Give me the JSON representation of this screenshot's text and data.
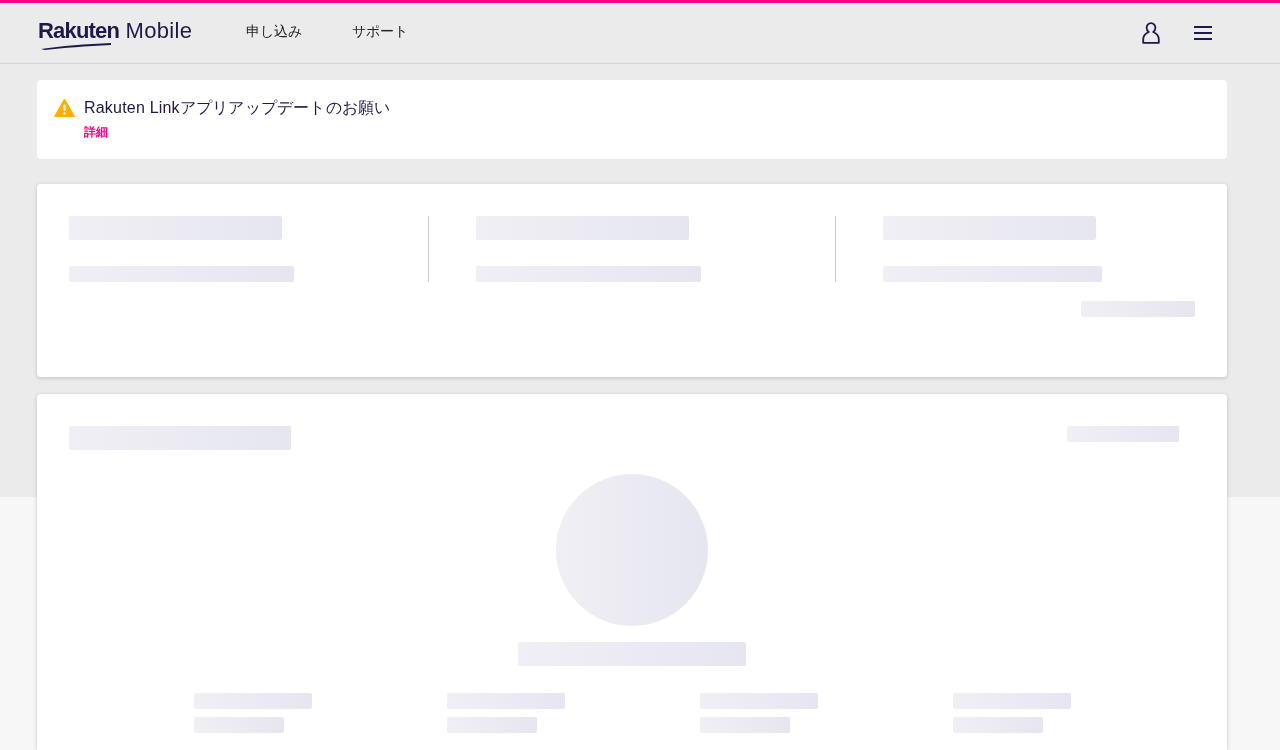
{
  "header": {
    "logo": "**Rakuten** Mobile",
    "nav": [
      {
        "label": "申し込み"
      },
      {
        "label": "サポート"
      }
    ]
  },
  "notice": {
    "kind": "warning",
    "title": "Rakuten Linkアプリアップデートのお願い",
    "link": "詳細"
  },
  "summary_card": {
    "loading": true
  },
  "detail_card": {
    "loading": true
  }
}
